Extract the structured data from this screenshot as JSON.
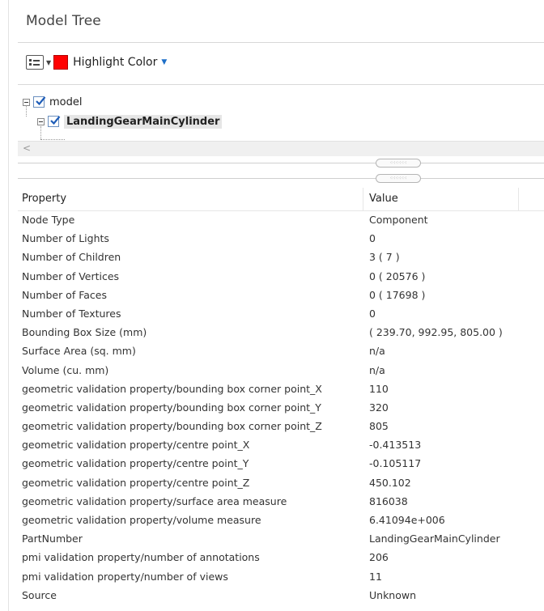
{
  "panel": {
    "title": "Model Tree"
  },
  "toolbar": {
    "view_icon": "list-view-icon",
    "highlight_label": "Highlight Color",
    "highlight_color": "#ff0000"
  },
  "tree": {
    "nodes": [
      {
        "label": "model",
        "checked": true,
        "expanded": true
      },
      {
        "label": "LandingGearMainCylinder",
        "checked": true,
        "expanded": true,
        "selected": true
      }
    ]
  },
  "properties": {
    "header_property": "Property",
    "header_value": "Value",
    "rows": [
      {
        "property": "Node Type",
        "value": "Component"
      },
      {
        "property": "Number of Lights",
        "value": "0"
      },
      {
        "property": "Number of Children",
        "value": "3 ( 7 )"
      },
      {
        "property": "Number of Vertices",
        "value": "0 ( 20576 )"
      },
      {
        "property": "Number of Faces",
        "value": "0 ( 17698 )"
      },
      {
        "property": "Number of Textures",
        "value": "0"
      },
      {
        "property": "Bounding Box Size (mm)",
        "value": "( 239.70, 992.95, 805.00 )"
      },
      {
        "property": "Surface Area (sq. mm)",
        "value": "n/a"
      },
      {
        "property": "Volume (cu. mm)",
        "value": "n/a"
      },
      {
        "property": "geometric validation property/bounding box corner point_X",
        "value": "110"
      },
      {
        "property": "geometric validation property/bounding box corner point_Y",
        "value": "320"
      },
      {
        "property": "geometric validation property/bounding box corner point_Z",
        "value": "805"
      },
      {
        "property": "geometric validation property/centre point_X",
        "value": "-0.413513"
      },
      {
        "property": "geometric validation property/centre point_Y",
        "value": "-0.105117"
      },
      {
        "property": "geometric validation property/centre point_Z",
        "value": "450.102"
      },
      {
        "property": "geometric validation property/surface area measure",
        "value": "816038"
      },
      {
        "property": "geometric validation property/volume measure",
        "value": "6.41094e+006"
      },
      {
        "property": "PartNumber",
        "value": "LandingGearMainCylinder"
      },
      {
        "property": "pmi validation property/number of annotations",
        "value": "206"
      },
      {
        "property": "pmi validation property/number of views",
        "value": "11"
      },
      {
        "property": "Source",
        "value": "Unknown"
      }
    ]
  }
}
